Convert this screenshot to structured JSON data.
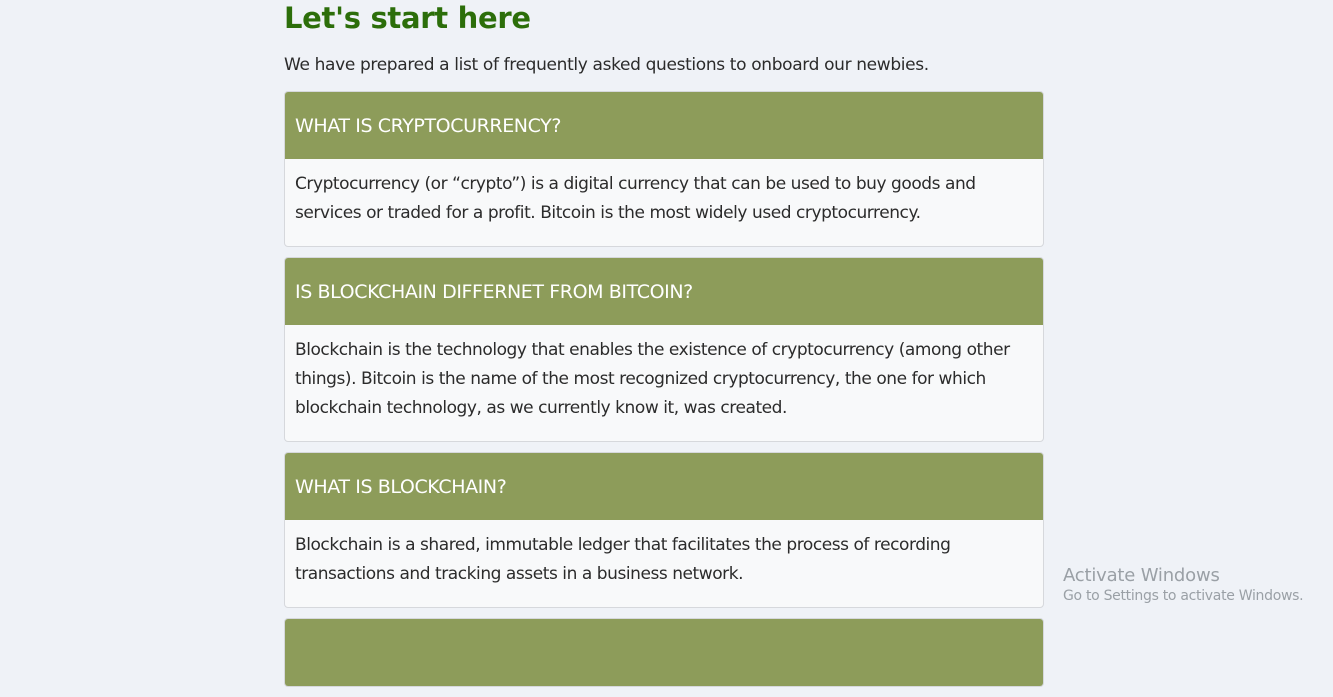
{
  "page": {
    "title": "Let's start here",
    "intro": "We have prepared a list of frequently asked questions to onboard our newbies."
  },
  "faq": [
    {
      "question": "WHAT IS CRYPTOCURRENCY?",
      "answer": "Cryptocurrency (or “crypto”) is a digital currency that can be used to buy goods and services or traded for a profit. Bitcoin is the most widely used cryptocurrency."
    },
    {
      "question": "IS BLOCKCHAIN DIFFERNET FROM BITCOIN?",
      "answer": "Blockchain is the technology that enables the existence of cryptocurrency (among other things). Bitcoin is the name of the most recognized cryptocurrency, the one for which blockchain technology, as we currently know it, was created."
    },
    {
      "question": "WHAT IS BLOCKCHAIN?",
      "answer": "Blockchain is a shared, immutable ledger that facilitates the process of recording transactions and tracking assets in a business network."
    },
    {
      "question": "",
      "answer": ""
    }
  ],
  "watermark": {
    "title": "Activate Windows",
    "subtitle": "Go to Settings to activate Windows."
  },
  "colors": {
    "title": "#2c6e0a",
    "card_header": "#8d9c5a",
    "background": "#eff2f7"
  }
}
